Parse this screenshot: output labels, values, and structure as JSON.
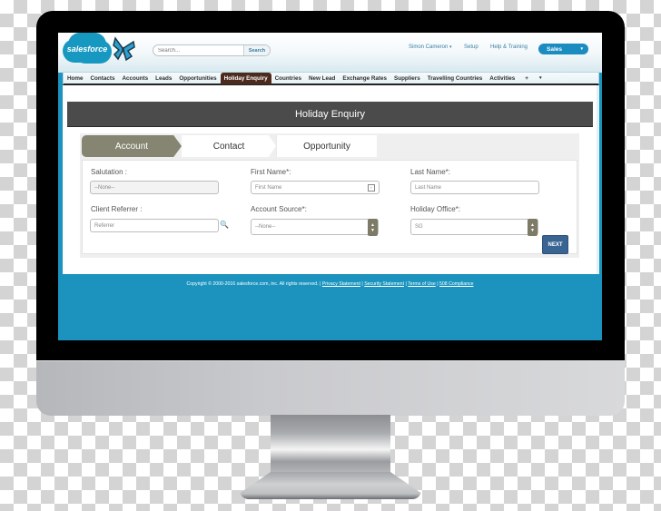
{
  "header": {
    "logo_text": "salesforce",
    "search": {
      "placeholder": "Search...",
      "button_label": "Search"
    },
    "user_menu": "Simon Cameron",
    "user_caret": "▾",
    "setup_label": "Setup",
    "help_label": "Help & Training",
    "app_selector": {
      "value": "Sales",
      "caret": "▾"
    }
  },
  "nav": {
    "tabs": [
      {
        "label": "Home"
      },
      {
        "label": "Contacts"
      },
      {
        "label": "Accounts"
      },
      {
        "label": "Leads"
      },
      {
        "label": "Opportunities"
      },
      {
        "label": "Holiday Enquiry",
        "active": true
      },
      {
        "label": "Countries"
      },
      {
        "label": "New Lead"
      },
      {
        "label": "Exchange Rates"
      },
      {
        "label": "Suppliers"
      },
      {
        "label": "Travelling Countries"
      },
      {
        "label": "Activities"
      },
      {
        "label": "+"
      },
      {
        "label": "▾"
      }
    ]
  },
  "page": {
    "title": "Holiday Enquiry",
    "steps": [
      {
        "label": "Account",
        "active": true
      },
      {
        "label": "Contact"
      },
      {
        "label": "Opportunity"
      }
    ],
    "form": {
      "salutation": {
        "label": "Salutation :",
        "value": "--None--"
      },
      "first_name": {
        "label": "First Name*:",
        "placeholder": "First Name"
      },
      "last_name": {
        "label": "Last Name*:",
        "placeholder": "Last Name"
      },
      "client_referrer": {
        "label": "Client Referrer :",
        "placeholder": "Referrer"
      },
      "account_source": {
        "label": "Account Source*:",
        "value": "--None--"
      },
      "holiday_office": {
        "label": "Holiday Office*:",
        "value": "SG"
      }
    },
    "next_label": "NEXT"
  },
  "footer": {
    "copyright": "Copyright © 2000-2016 salesforce.com, inc. All rights reserved. |",
    "links": [
      "Privacy Statement",
      "Security Statement",
      "Terms of Use",
      "508 Compliance"
    ],
    "separator": "|"
  },
  "colors": {
    "brand_blue": "#1798c1",
    "active_tab": "#4c2b1f",
    "title_bar": "#4b4b4b",
    "active_step": "#858571",
    "next_button": "#3a6593",
    "screen_background": "#1b93be"
  }
}
